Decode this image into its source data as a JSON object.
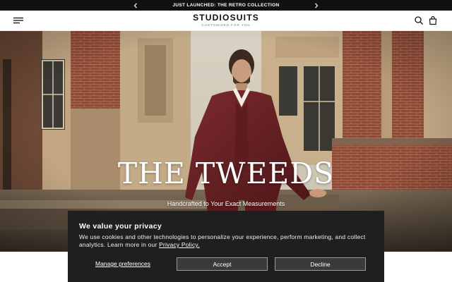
{
  "announcement": {
    "text": "JUST LAUNCHED: THE RETRO COLLECTION",
    "prev_icon": "chevron-left-icon",
    "next_icon": "chevron-right-icon"
  },
  "header": {
    "brand": "STUDIOSUITS",
    "tagline": "CUSTOMIZED FOR YOU",
    "menu_icon": "hamburger-menu-icon",
    "search_icon": "search-icon",
    "bag_icon": "shopping-bag-icon"
  },
  "hero": {
    "title": "THE TWEEDS",
    "subtitle": "Handcrafted to Your Exact Measurements"
  },
  "cookie": {
    "title": "We value your privacy",
    "body": "We use cookies and other technologies to personalize your experience, perform marketing, and collect analytics. Learn more in our",
    "policy_link": "Privacy Policy.",
    "manage_label": "Manage preferences",
    "accept_label": "Accept",
    "decline_label": "Decline"
  },
  "colors": {
    "announcement_bg": "#111111",
    "banner_bg": "#1f1f1f",
    "button_bg": "#3a3a3a",
    "suit": "#6e2226"
  }
}
